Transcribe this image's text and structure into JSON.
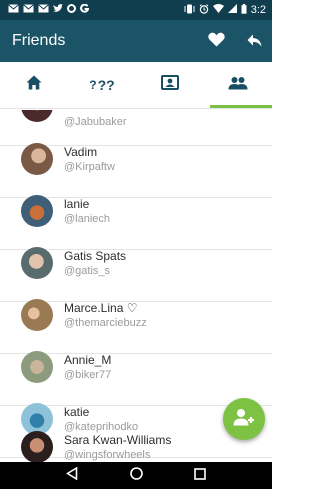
{
  "status_bar": {
    "time": "3:2",
    "left_icons": [
      "mail-icon",
      "mail-icon",
      "mail-icon",
      "twitter-icon",
      "circle-icon",
      "g-icon"
    ],
    "right_icons": [
      "vibrate-icon",
      "alarm-icon",
      "wifi-icon",
      "signal-icon",
      "battery-icon"
    ]
  },
  "app_bar": {
    "title": "Friends",
    "actions": [
      "heart-icon",
      "reply-icon"
    ]
  },
  "tabs": [
    {
      "icon": "home-icon",
      "active": false
    },
    {
      "label": "??",
      "icon": "question-icon",
      "active": false
    },
    {
      "icon": "contact-card-icon",
      "active": false
    },
    {
      "icon": "people-icon",
      "active": true
    }
  ],
  "friends": [
    {
      "name": "",
      "handle": "@Jabubaker"
    },
    {
      "name": "Vadim",
      "handle": "@Kirpaftw"
    },
    {
      "name": "lanie",
      "handle": "@laniech"
    },
    {
      "name": "Gatis Spats",
      "handle": "@gatis_s"
    },
    {
      "name": "Marce.Lina ♡",
      "handle": "@themarciebuzz"
    },
    {
      "name": "Annie_M",
      "handle": "@biker77"
    },
    {
      "name": "katie",
      "handle": "@kateprihodko"
    },
    {
      "name": "Sara Kwan-Williams",
      "handle": "@wingsforwheels"
    }
  ],
  "fab": {
    "icon": "add-person-icon"
  },
  "nav_bar": [
    "back-icon",
    "home-icon",
    "recents-icon"
  ],
  "colors": {
    "status_bar": "#113e4f",
    "app_bar": "#1a5466",
    "accent": "#7bc043",
    "fab": "#7dc242",
    "icon": "#1a4f63"
  }
}
